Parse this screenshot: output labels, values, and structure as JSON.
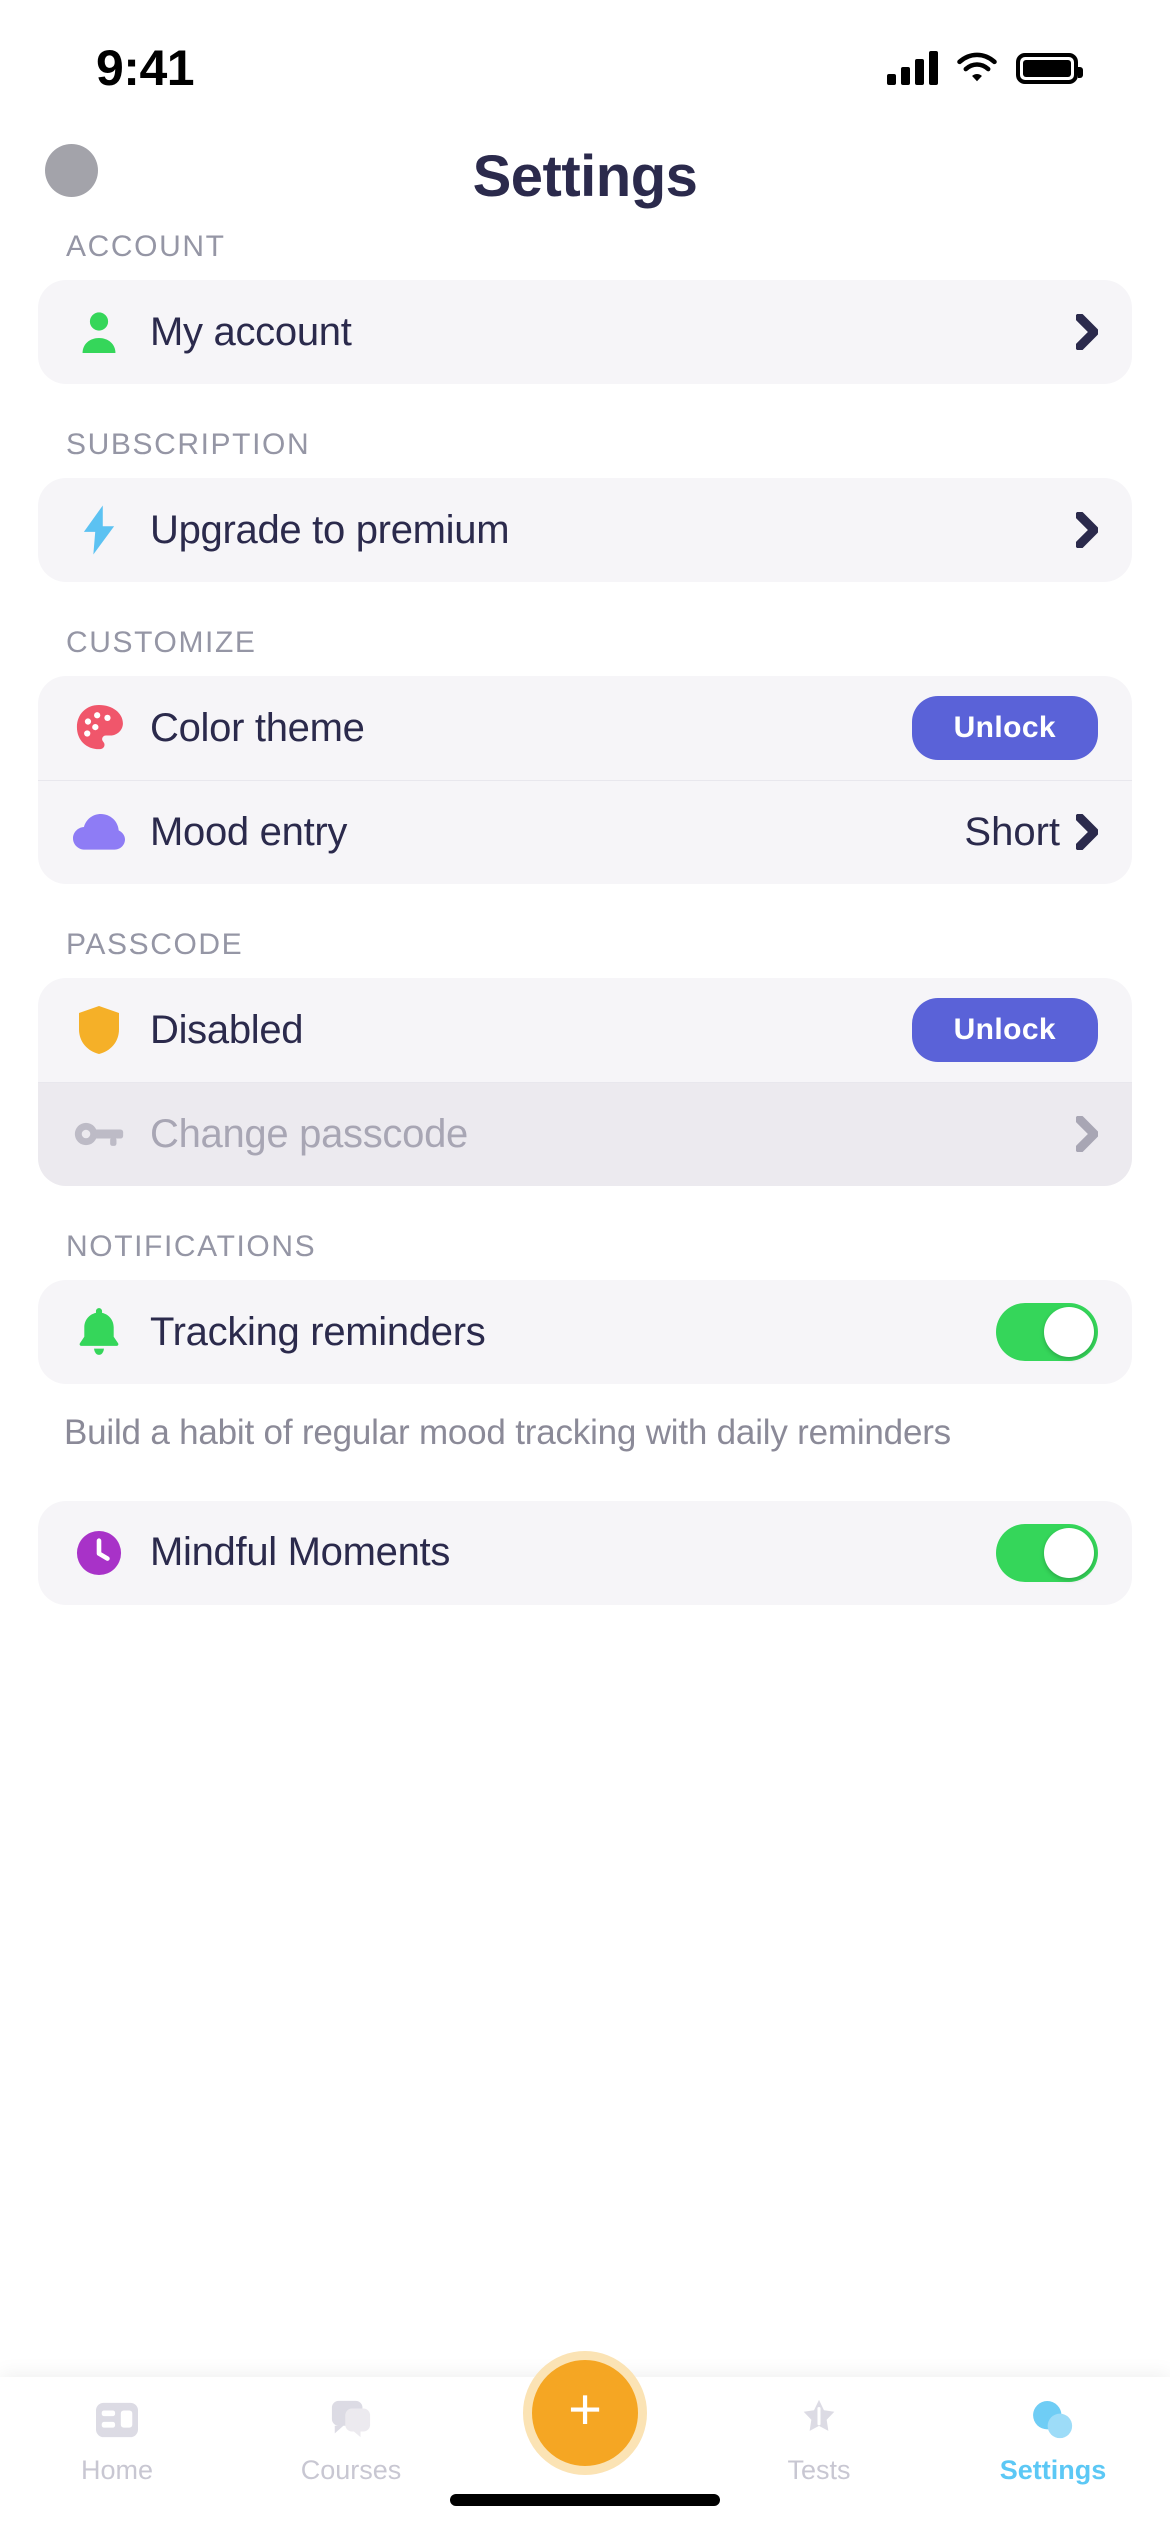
{
  "status_bar": {
    "time": "9:41",
    "signal_icon": "cellular-signal-icon",
    "wifi_icon": "wifi-icon",
    "battery_icon": "battery-icon"
  },
  "header": {
    "title": "Settings",
    "avatar_label": ""
  },
  "sections": [
    {
      "label": "ACCOUNT",
      "rows": [
        {
          "icon": "person-icon",
          "label": "My account",
          "accessory": "chevron",
          "color": "#35d65a"
        }
      ]
    },
    {
      "label": "SUBSCRIPTION",
      "rows": [
        {
          "icon": "lightning-bolt-icon",
          "label": "Upgrade to premium",
          "accessory": "chevron",
          "color": "#5cc2f2"
        }
      ]
    },
    {
      "label": "CUSTOMIZE",
      "rows": [
        {
          "icon": "palette-icon",
          "label": "Color theme",
          "accessory": "button",
          "button_label": "Unlock",
          "color": "#f0566b"
        },
        {
          "icon": "cloud-icon",
          "label": "Mood entry",
          "accessory": "value-chevron",
          "value": "Short",
          "color": "#8e7cf5"
        }
      ]
    },
    {
      "label": "PASSCODE",
      "rows": [
        {
          "icon": "shield-icon",
          "label": "Disabled",
          "accessory": "button",
          "button_label": "Unlock",
          "color": "#f5b028"
        },
        {
          "icon": "key-icon",
          "label": "Change passcode",
          "accessory": "chevron",
          "color": "#bdbbc6",
          "disabled": true
        }
      ]
    },
    {
      "label": "NOTIFICATIONS",
      "rows": [
        {
          "icon": "bell-icon",
          "label": "Tracking reminders",
          "accessory": "toggle",
          "toggle_on": true,
          "color": "#35d65a"
        }
      ],
      "helper": "Build a habit of regular mood tracking with daily reminders"
    },
    {
      "label": "",
      "rows": [
        {
          "icon": "clock-icon",
          "label": "Mindful Moments",
          "accessory": "toggle",
          "toggle_on": true,
          "color": "#a832c8"
        }
      ]
    }
  ],
  "colors": {
    "accent_unlock": "#5a62d8",
    "toggle_on": "#35d65a",
    "fab": "#f5a623",
    "active_tab": "#5cc8f5",
    "title": "#2b2a4c",
    "card_bg": "#f6f5f8"
  },
  "tabbar": {
    "items": [
      {
        "label": "Home",
        "icon": "home-icon",
        "active": false
      },
      {
        "label": "Courses",
        "icon": "courses-icon",
        "active": false
      },
      {
        "label": "Tests",
        "icon": "tests-icon",
        "active": false
      },
      {
        "label": "Settings",
        "icon": "settings-icon",
        "active": true
      }
    ],
    "fab_label": "+"
  }
}
